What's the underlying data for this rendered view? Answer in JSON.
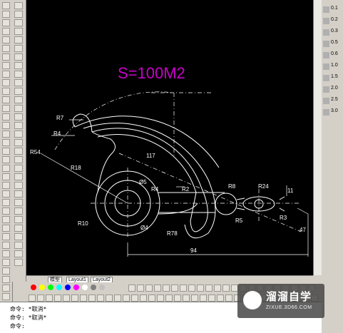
{
  "drawing": {
    "area_label": "S=100M2",
    "area_color": "#c800c8",
    "dims": {
      "r7": "R7",
      "r4_left": "R4",
      "r54": "R54",
      "r18": "R18",
      "r10": "R10",
      "r4_mid": "R4",
      "r2": "R2",
      "r8": "R8",
      "r24": "R24",
      "r5": "R5",
      "r3": "R3",
      "d94": "94",
      "angle1": "117",
      "d50": "Ø5",
      "d44": "Ø4",
      "r78": "R78",
      "r1": "11",
      "v1": "47"
    }
  },
  "layout_tabs": [
    "模型",
    "Layout1",
    "Layout2"
  ],
  "command_lines": [
    "命令: *取消*",
    "命令: *取消*",
    "命令:"
  ],
  "property_colors": [
    "#ff0000",
    "#ffff00",
    "#00ff00",
    "#00ffff",
    "#0000ff",
    "#ff00ff",
    "#ffffff",
    "#808080",
    "#c0c0c0"
  ],
  "right_panel": [
    "0.1",
    "0.2",
    "0.3",
    "0.5",
    "0.6",
    "1.0",
    "1.5",
    "2.0",
    "2.5",
    "3.0"
  ],
  "watermark": {
    "title": "溜溜自学",
    "url": "ZIXUE.3D66.COM"
  }
}
